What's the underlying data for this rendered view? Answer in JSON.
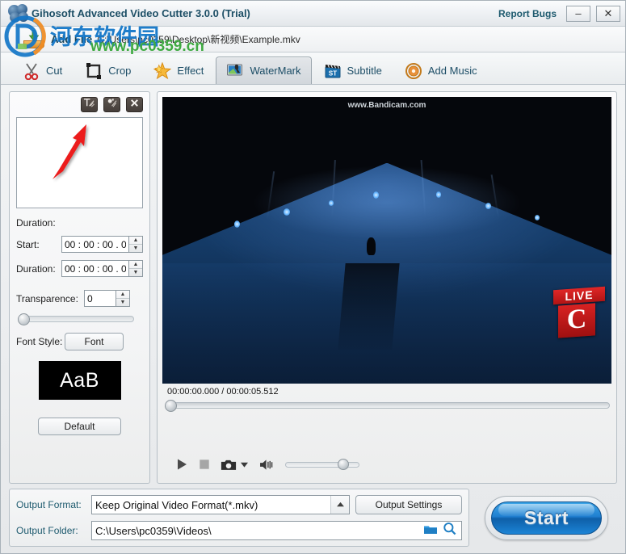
{
  "window": {
    "title": "Gihosoft Advanced Video Cutter 3.0.0 (Trial)",
    "report_bugs": "Report Bugs",
    "minimize": "–",
    "close": "✕",
    "app_logo_icon": "film-reel-icon"
  },
  "addfile": {
    "label": "Add File",
    "path": "C:\\Users\\pc0359\\Desktop\\新视频\\Example.mkv",
    "icon": "add-file-tray-icon"
  },
  "tabs": [
    {
      "label": "Cut",
      "icon": "scissors-icon",
      "active": false
    },
    {
      "label": "Crop",
      "icon": "crop-frame-icon",
      "active": false
    },
    {
      "label": "Effect",
      "icon": "star-burst-icon",
      "active": false
    },
    {
      "label": "WaterMark",
      "icon": "watermark-monitor-icon",
      "active": true
    },
    {
      "label": "Subtitle",
      "icon": "clapperboard-st-icon",
      "active": false
    },
    {
      "label": "Add Music",
      "icon": "audio-disc-icon",
      "active": false
    }
  ],
  "watermark_panel": {
    "toolbar": [
      {
        "name": "add-text-watermark-button",
        "icon": "text-watermark-icon"
      },
      {
        "name": "add-image-watermark-button",
        "icon": "image-watermark-icon"
      },
      {
        "name": "remove-watermark-button",
        "icon": "close-x-icon"
      }
    ],
    "list_items": [],
    "duration_header": "Duration:",
    "start_label": "Start:",
    "start_value": "00 : 00 : 00 . 000",
    "duration_label": "Duration:",
    "duration_value": "00 : 00 : 00 . 000",
    "transparence_label": "Transparence:",
    "transparence_value": "0",
    "transparence_slider_percent": 0,
    "font_style_label": "Font Style:",
    "font_button": "Font",
    "font_preview_text": "AaB",
    "font_preview_bg": "#000000",
    "font_preview_fg": "#ffffff",
    "default_button": "Default"
  },
  "preview": {
    "overlay_watermark": "www.Bandicam.com",
    "scene_badge_live": "LIVE",
    "scene_badge_channel": "C",
    "current_time": "00:00:00.000",
    "total_time": "00:00:05.512",
    "time_readout": "00:00:00.000 / 00:00:05.512",
    "seek_percent": 0,
    "controls": [
      {
        "name": "play-button",
        "icon": "play-icon"
      },
      {
        "name": "stop-button",
        "icon": "stop-square-icon"
      },
      {
        "name": "snapshot-button",
        "icon": "camera-icon"
      },
      {
        "name": "snapshot-menu",
        "icon": "chevron-down-icon"
      },
      {
        "name": "mute-button",
        "icon": "speaker-icon"
      }
    ],
    "volume_percent": 80
  },
  "output": {
    "format_label": "Output Format:",
    "format_value": "Keep Original Video Format(*.mkv)",
    "format_dropdown_icon": "chevron-up-icon",
    "settings_button": "Output Settings",
    "folder_label": "Output Folder:",
    "folder_value": "C:\\Users\\pc0359\\Videos\\",
    "browse_icon": "folder-icon",
    "search_icon": "magnifier-icon",
    "start_button": "Start"
  },
  "site_watermark": {
    "logo_icon": "site-logo-icon",
    "chinese_text": "河东软件园",
    "url_text": "www.pc0359.cn"
  },
  "colors": {
    "accent_blue": "#1f7fd0",
    "label_teal": "#1d5a6e",
    "title_teal": "#1d4f66",
    "annotation_red": "#e81515",
    "live_red": "#d82222",
    "watermark_blue": "#1477c8",
    "watermark_green": "#3faa42"
  }
}
